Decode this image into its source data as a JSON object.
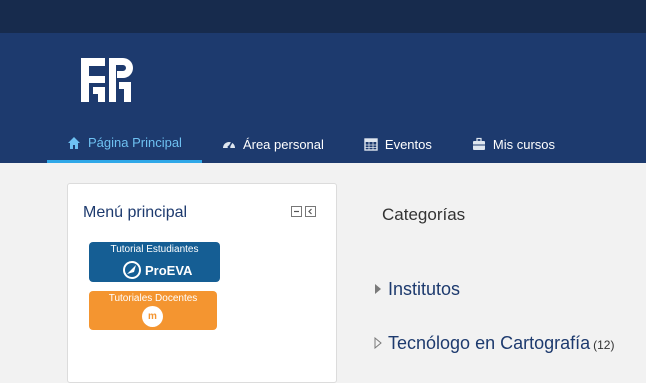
{
  "nav": {
    "items": [
      {
        "label": "Página Principal",
        "icon": "home-icon",
        "active": true
      },
      {
        "label": "Área personal",
        "icon": "dashboard-icon",
        "active": false
      },
      {
        "label": "Eventos",
        "icon": "calendar-icon",
        "active": false
      },
      {
        "label": "Mis cursos",
        "icon": "briefcase-icon",
        "active": false
      }
    ]
  },
  "block": {
    "title": "Menú principal",
    "tutorial_estudiantes": {
      "line1": "Tutorial Estudiantes",
      "line2": "ProEVA"
    },
    "tutoriales_docentes": {
      "line1": "Tutoriales Docentes",
      "logo_text": "m"
    }
  },
  "categories": {
    "title": "Categorías",
    "items": [
      {
        "name": "Institutos",
        "count": ""
      },
      {
        "name": "Tecnólogo en Cartografía",
        "count": "(12)"
      }
    ]
  },
  "colors": {
    "topbar": "#172b4d",
    "header": "#1d3a6e",
    "active_tab": "#2fa8e8",
    "student_button": "#155e94",
    "teacher_button": "#f49530"
  }
}
